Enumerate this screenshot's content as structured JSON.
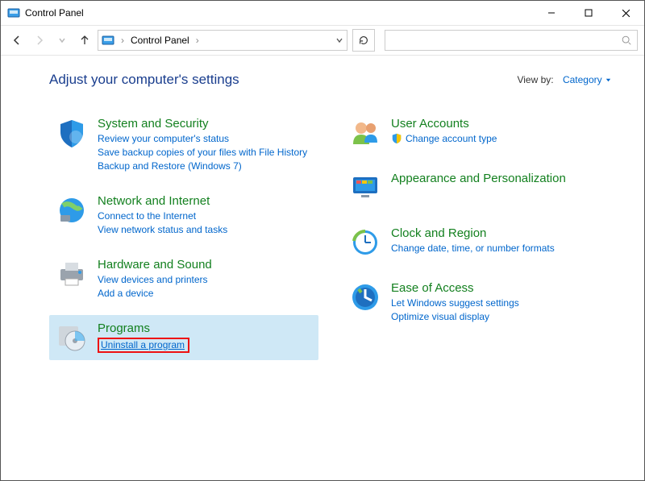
{
  "window": {
    "title": "Control Panel"
  },
  "address": {
    "root": "Control Panel"
  },
  "header": {
    "heading": "Adjust your computer's settings",
    "view_by_label": "View by:",
    "view_by_value": "Category"
  },
  "left": {
    "system": {
      "title": "System and Security",
      "links": [
        "Review your computer's status",
        "Save backup copies of your files with File History",
        "Backup and Restore (Windows 7)"
      ]
    },
    "network": {
      "title": "Network and Internet",
      "links": [
        "Connect to the Internet",
        "View network status and tasks"
      ]
    },
    "hardware": {
      "title": "Hardware and Sound",
      "links": [
        "View devices and printers",
        "Add a device"
      ]
    },
    "programs": {
      "title": "Programs",
      "links": [
        "Uninstall a program"
      ]
    }
  },
  "right": {
    "users": {
      "title": "User Accounts",
      "links": [
        "Change account type"
      ]
    },
    "appearance": {
      "title": "Appearance and Personalization"
    },
    "clock": {
      "title": "Clock and Region",
      "links": [
        "Change date, time, or number formats"
      ]
    },
    "ease": {
      "title": "Ease of Access",
      "links": [
        "Let Windows suggest settings",
        "Optimize visual display"
      ]
    }
  }
}
